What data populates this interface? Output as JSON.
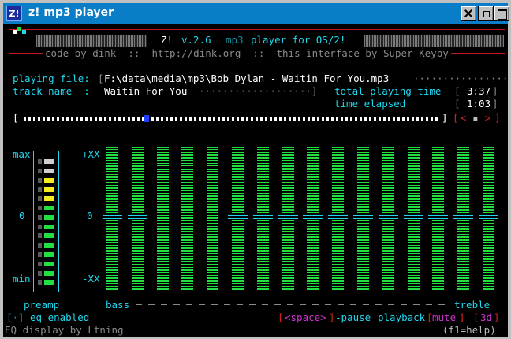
{
  "window": {
    "icon_text": "Z!",
    "title": "z! mp3 player"
  },
  "header": {
    "title_left": "Z!",
    "version": "v.2.6",
    "tagline_a": "mp3",
    "tagline_b": "player for OS/2!",
    "credits": "code by dink  ::  http://dink.org  ::  this interface by Super Keyby"
  },
  "info": {
    "playing_file_label": "playing file:",
    "playing_file_value": "F:\\data\\media\\mp3\\Bob Dylan - Waitin For You.mp3",
    "track_name_label": "track name  :",
    "track_name_value": "Waitin For You",
    "total_time_label": "total playing time",
    "total_time_value": "3:37",
    "elapsed_label": "time elapsed",
    "elapsed_value": "1:03"
  },
  "progress": {
    "fraction": 0.29,
    "nav_prev": "<",
    "nav_stop": "▪",
    "nav_next": ">"
  },
  "eq": {
    "max_label": "max",
    "zero_label": "0",
    "min_label": "min",
    "plus_label": "+XX",
    "minus_label": "-XX",
    "preamp_label": "preamp",
    "bass_label": "bass",
    "treble_label": "treble",
    "preamp_levels": [
      "off",
      "off",
      "yellow",
      "yellow",
      "yellow",
      "green",
      "green",
      "green",
      "green",
      "green",
      "green",
      "green",
      "green",
      "green"
    ],
    "bands": [
      0,
      0,
      1,
      1,
      1,
      0,
      0,
      0,
      0,
      0,
      0,
      0,
      0,
      0,
      0,
      0
    ],
    "colors": {
      "cyan": "#20d6ec",
      "green": "#22e040",
      "yellow": "#f4ec20",
      "red": "#e02020"
    }
  },
  "status": {
    "eq_toggle": "[·]",
    "eq_enabled": "eq enabled",
    "space_key": "<space>",
    "pause_label": "-pause",
    "playback_label": "playback",
    "mute_label": "mute",
    "view_num": "3d",
    "help_label": "(f1=help)",
    "eq_credit": "EQ display by Ltning"
  }
}
